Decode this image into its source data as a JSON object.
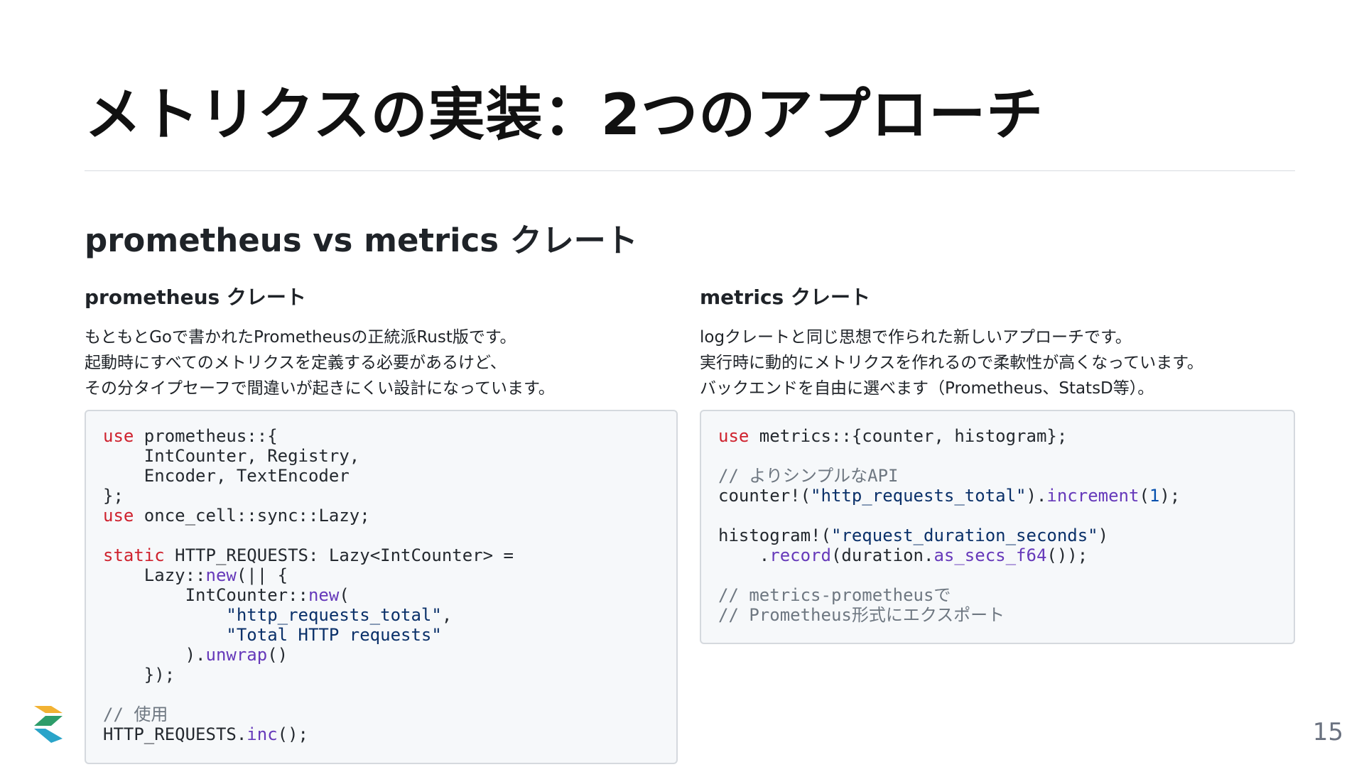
{
  "slide": {
    "title": "メトリクスの実装：2つのアプローチ",
    "section_heading": "prometheus vs metrics クレート",
    "page_number": "15"
  },
  "left": {
    "heading": "prometheus クレート",
    "description": [
      "もともとGoで書かれたPrometheusの正統派Rust版です。",
      "起動時にすべてのメトリクスを定義する必要があるけど、",
      "その分タイプセーフで間違いが起きにくい設計になっています。"
    ],
    "code": [
      [
        {
          "t": "use",
          "c": "kw"
        },
        {
          "t": " prometheus::{",
          "c": "plain"
        }
      ],
      [
        {
          "t": "    IntCounter, Registry,",
          "c": "plain"
        }
      ],
      [
        {
          "t": "    Encoder, TextEncoder",
          "c": "plain"
        }
      ],
      [
        {
          "t": "};",
          "c": "plain"
        }
      ],
      [
        {
          "t": "use",
          "c": "kw"
        },
        {
          "t": " once_cell::sync::Lazy;",
          "c": "plain"
        }
      ],
      [
        {
          "t": "",
          "c": "plain"
        }
      ],
      [
        {
          "t": "static",
          "c": "kw"
        },
        {
          "t": " HTTP_REQUESTS: Lazy<IntCounter> =",
          "c": "plain"
        }
      ],
      [
        {
          "t": "    Lazy::",
          "c": "plain"
        },
        {
          "t": "new",
          "c": "fn"
        },
        {
          "t": "(|| {",
          "c": "plain"
        }
      ],
      [
        {
          "t": "        IntCounter::",
          "c": "plain"
        },
        {
          "t": "new",
          "c": "fn"
        },
        {
          "t": "(",
          "c": "plain"
        }
      ],
      [
        {
          "t": "            ",
          "c": "plain"
        },
        {
          "t": "\"http_requests_total\"",
          "c": "str"
        },
        {
          "t": ",",
          "c": "plain"
        }
      ],
      [
        {
          "t": "            ",
          "c": "plain"
        },
        {
          "t": "\"Total HTTP requests\"",
          "c": "str"
        }
      ],
      [
        {
          "t": "        ).",
          "c": "plain"
        },
        {
          "t": "unwrap",
          "c": "fn"
        },
        {
          "t": "()",
          "c": "plain"
        }
      ],
      [
        {
          "t": "    });",
          "c": "plain"
        }
      ],
      [
        {
          "t": "",
          "c": "plain"
        }
      ],
      [
        {
          "t": "// 使用",
          "c": "cm"
        }
      ],
      [
        {
          "t": "HTTP_REQUESTS.",
          "c": "plain"
        },
        {
          "t": "inc",
          "c": "fn"
        },
        {
          "t": "();",
          "c": "plain"
        }
      ]
    ]
  },
  "right": {
    "heading": "metrics クレート",
    "description": [
      "logクレートと同じ思想で作られた新しいアプローチです。",
      "実行時に動的にメトリクスを作れるので柔軟性が高くなっています。",
      "バックエンドを自由に選べます（Prometheus、StatsD等）。"
    ],
    "code": [
      [
        {
          "t": "use",
          "c": "kw"
        },
        {
          "t": " metrics::{counter, histogram};",
          "c": "plain"
        }
      ],
      [
        {
          "t": "",
          "c": "plain"
        }
      ],
      [
        {
          "t": "// よりシンプルなAPI",
          "c": "cm"
        }
      ],
      [
        {
          "t": "counter!(",
          "c": "plain"
        },
        {
          "t": "\"http_requests_total\"",
          "c": "str"
        },
        {
          "t": ").",
          "c": "plain"
        },
        {
          "t": "increment",
          "c": "fn"
        },
        {
          "t": "(",
          "c": "plain"
        },
        {
          "t": "1",
          "c": "num"
        },
        {
          "t": ");",
          "c": "plain"
        }
      ],
      [
        {
          "t": "",
          "c": "plain"
        }
      ],
      [
        {
          "t": "histogram!(",
          "c": "plain"
        },
        {
          "t": "\"request_duration_seconds\"",
          "c": "str"
        },
        {
          "t": ")",
          "c": "plain"
        }
      ],
      [
        {
          "t": "    .",
          "c": "plain"
        },
        {
          "t": "record",
          "c": "fn"
        },
        {
          "t": "(duration.",
          "c": "plain"
        },
        {
          "t": "as_secs_f64",
          "c": "fn"
        },
        {
          "t": "());",
          "c": "plain"
        }
      ],
      [
        {
          "t": "",
          "c": "plain"
        }
      ],
      [
        {
          "t": "// metrics-prometheusで",
          "c": "cm"
        }
      ],
      [
        {
          "t": "// Prometheus形式にエクスポート",
          "c": "cm"
        }
      ]
    ]
  },
  "logo": {
    "icon": "chevron-stack-logo-icon",
    "colors": [
      "#f2b233",
      "#2e9d6a",
      "#2aa4c9"
    ]
  }
}
